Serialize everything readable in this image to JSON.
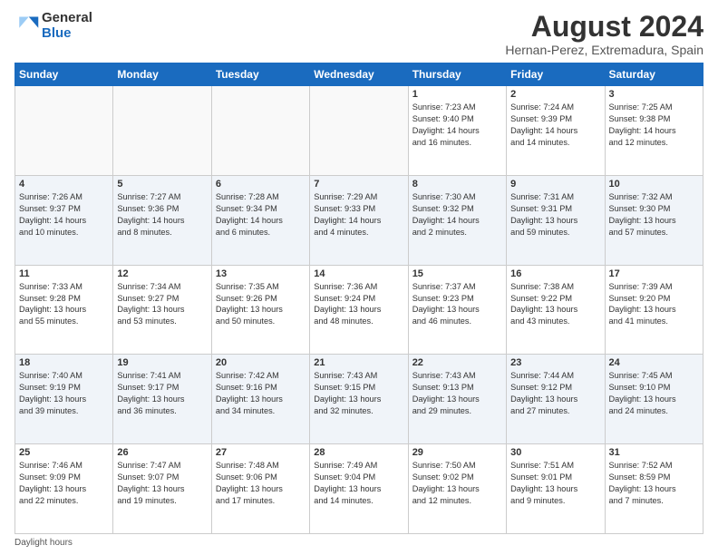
{
  "logo": {
    "general": "General",
    "blue": "Blue"
  },
  "title": "August 2024",
  "subtitle": "Hernan-Perez, Extremadura, Spain",
  "days_of_week": [
    "Sunday",
    "Monday",
    "Tuesday",
    "Wednesday",
    "Thursday",
    "Friday",
    "Saturday"
  ],
  "weeks": [
    [
      {
        "day": "",
        "info": ""
      },
      {
        "day": "",
        "info": ""
      },
      {
        "day": "",
        "info": ""
      },
      {
        "day": "",
        "info": ""
      },
      {
        "day": "1",
        "info": "Sunrise: 7:23 AM\nSunset: 9:40 PM\nDaylight: 14 hours\nand 16 minutes."
      },
      {
        "day": "2",
        "info": "Sunrise: 7:24 AM\nSunset: 9:39 PM\nDaylight: 14 hours\nand 14 minutes."
      },
      {
        "day": "3",
        "info": "Sunrise: 7:25 AM\nSunset: 9:38 PM\nDaylight: 14 hours\nand 12 minutes."
      }
    ],
    [
      {
        "day": "4",
        "info": "Sunrise: 7:26 AM\nSunset: 9:37 PM\nDaylight: 14 hours\nand 10 minutes."
      },
      {
        "day": "5",
        "info": "Sunrise: 7:27 AM\nSunset: 9:36 PM\nDaylight: 14 hours\nand 8 minutes."
      },
      {
        "day": "6",
        "info": "Sunrise: 7:28 AM\nSunset: 9:34 PM\nDaylight: 14 hours\nand 6 minutes."
      },
      {
        "day": "7",
        "info": "Sunrise: 7:29 AM\nSunset: 9:33 PM\nDaylight: 14 hours\nand 4 minutes."
      },
      {
        "day": "8",
        "info": "Sunrise: 7:30 AM\nSunset: 9:32 PM\nDaylight: 14 hours\nand 2 minutes."
      },
      {
        "day": "9",
        "info": "Sunrise: 7:31 AM\nSunset: 9:31 PM\nDaylight: 13 hours\nand 59 minutes."
      },
      {
        "day": "10",
        "info": "Sunrise: 7:32 AM\nSunset: 9:30 PM\nDaylight: 13 hours\nand 57 minutes."
      }
    ],
    [
      {
        "day": "11",
        "info": "Sunrise: 7:33 AM\nSunset: 9:28 PM\nDaylight: 13 hours\nand 55 minutes."
      },
      {
        "day": "12",
        "info": "Sunrise: 7:34 AM\nSunset: 9:27 PM\nDaylight: 13 hours\nand 53 minutes."
      },
      {
        "day": "13",
        "info": "Sunrise: 7:35 AM\nSunset: 9:26 PM\nDaylight: 13 hours\nand 50 minutes."
      },
      {
        "day": "14",
        "info": "Sunrise: 7:36 AM\nSunset: 9:24 PM\nDaylight: 13 hours\nand 48 minutes."
      },
      {
        "day": "15",
        "info": "Sunrise: 7:37 AM\nSunset: 9:23 PM\nDaylight: 13 hours\nand 46 minutes."
      },
      {
        "day": "16",
        "info": "Sunrise: 7:38 AM\nSunset: 9:22 PM\nDaylight: 13 hours\nand 43 minutes."
      },
      {
        "day": "17",
        "info": "Sunrise: 7:39 AM\nSunset: 9:20 PM\nDaylight: 13 hours\nand 41 minutes."
      }
    ],
    [
      {
        "day": "18",
        "info": "Sunrise: 7:40 AM\nSunset: 9:19 PM\nDaylight: 13 hours\nand 39 minutes."
      },
      {
        "day": "19",
        "info": "Sunrise: 7:41 AM\nSunset: 9:17 PM\nDaylight: 13 hours\nand 36 minutes."
      },
      {
        "day": "20",
        "info": "Sunrise: 7:42 AM\nSunset: 9:16 PM\nDaylight: 13 hours\nand 34 minutes."
      },
      {
        "day": "21",
        "info": "Sunrise: 7:43 AM\nSunset: 9:15 PM\nDaylight: 13 hours\nand 32 minutes."
      },
      {
        "day": "22",
        "info": "Sunrise: 7:43 AM\nSunset: 9:13 PM\nDaylight: 13 hours\nand 29 minutes."
      },
      {
        "day": "23",
        "info": "Sunrise: 7:44 AM\nSunset: 9:12 PM\nDaylight: 13 hours\nand 27 minutes."
      },
      {
        "day": "24",
        "info": "Sunrise: 7:45 AM\nSunset: 9:10 PM\nDaylight: 13 hours\nand 24 minutes."
      }
    ],
    [
      {
        "day": "25",
        "info": "Sunrise: 7:46 AM\nSunset: 9:09 PM\nDaylight: 13 hours\nand 22 minutes."
      },
      {
        "day": "26",
        "info": "Sunrise: 7:47 AM\nSunset: 9:07 PM\nDaylight: 13 hours\nand 19 minutes."
      },
      {
        "day": "27",
        "info": "Sunrise: 7:48 AM\nSunset: 9:06 PM\nDaylight: 13 hours\nand 17 minutes."
      },
      {
        "day": "28",
        "info": "Sunrise: 7:49 AM\nSunset: 9:04 PM\nDaylight: 13 hours\nand 14 minutes."
      },
      {
        "day": "29",
        "info": "Sunrise: 7:50 AM\nSunset: 9:02 PM\nDaylight: 13 hours\nand 12 minutes."
      },
      {
        "day": "30",
        "info": "Sunrise: 7:51 AM\nSunset: 9:01 PM\nDaylight: 13 hours\nand 9 minutes."
      },
      {
        "day": "31",
        "info": "Sunrise: 7:52 AM\nSunset: 8:59 PM\nDaylight: 13 hours\nand 7 minutes."
      }
    ]
  ],
  "footer": "Daylight hours"
}
